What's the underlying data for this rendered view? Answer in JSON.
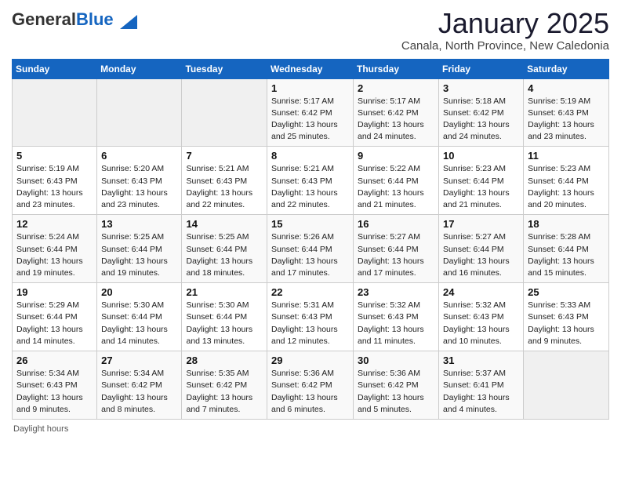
{
  "header": {
    "logo_general": "General",
    "logo_blue": "Blue",
    "title": "January 2025",
    "subtitle": "Canala, North Province, New Caledonia"
  },
  "days_of_week": [
    "Sunday",
    "Monday",
    "Tuesday",
    "Wednesday",
    "Thursday",
    "Friday",
    "Saturday"
  ],
  "weeks": [
    [
      {
        "day": "",
        "info": ""
      },
      {
        "day": "",
        "info": ""
      },
      {
        "day": "",
        "info": ""
      },
      {
        "day": "1",
        "info": "Sunrise: 5:17 AM\nSunset: 6:42 PM\nDaylight: 13 hours and 25 minutes."
      },
      {
        "day": "2",
        "info": "Sunrise: 5:17 AM\nSunset: 6:42 PM\nDaylight: 13 hours and 24 minutes."
      },
      {
        "day": "3",
        "info": "Sunrise: 5:18 AM\nSunset: 6:42 PM\nDaylight: 13 hours and 24 minutes."
      },
      {
        "day": "4",
        "info": "Sunrise: 5:19 AM\nSunset: 6:43 PM\nDaylight: 13 hours and 23 minutes."
      }
    ],
    [
      {
        "day": "5",
        "info": "Sunrise: 5:19 AM\nSunset: 6:43 PM\nDaylight: 13 hours and 23 minutes."
      },
      {
        "day": "6",
        "info": "Sunrise: 5:20 AM\nSunset: 6:43 PM\nDaylight: 13 hours and 23 minutes."
      },
      {
        "day": "7",
        "info": "Sunrise: 5:21 AM\nSunset: 6:43 PM\nDaylight: 13 hours and 22 minutes."
      },
      {
        "day": "8",
        "info": "Sunrise: 5:21 AM\nSunset: 6:43 PM\nDaylight: 13 hours and 22 minutes."
      },
      {
        "day": "9",
        "info": "Sunrise: 5:22 AM\nSunset: 6:44 PM\nDaylight: 13 hours and 21 minutes."
      },
      {
        "day": "10",
        "info": "Sunrise: 5:23 AM\nSunset: 6:44 PM\nDaylight: 13 hours and 21 minutes."
      },
      {
        "day": "11",
        "info": "Sunrise: 5:23 AM\nSunset: 6:44 PM\nDaylight: 13 hours and 20 minutes."
      }
    ],
    [
      {
        "day": "12",
        "info": "Sunrise: 5:24 AM\nSunset: 6:44 PM\nDaylight: 13 hours and 19 minutes."
      },
      {
        "day": "13",
        "info": "Sunrise: 5:25 AM\nSunset: 6:44 PM\nDaylight: 13 hours and 19 minutes."
      },
      {
        "day": "14",
        "info": "Sunrise: 5:25 AM\nSunset: 6:44 PM\nDaylight: 13 hours and 18 minutes."
      },
      {
        "day": "15",
        "info": "Sunrise: 5:26 AM\nSunset: 6:44 PM\nDaylight: 13 hours and 17 minutes."
      },
      {
        "day": "16",
        "info": "Sunrise: 5:27 AM\nSunset: 6:44 PM\nDaylight: 13 hours and 17 minutes."
      },
      {
        "day": "17",
        "info": "Sunrise: 5:27 AM\nSunset: 6:44 PM\nDaylight: 13 hours and 16 minutes."
      },
      {
        "day": "18",
        "info": "Sunrise: 5:28 AM\nSunset: 6:44 PM\nDaylight: 13 hours and 15 minutes."
      }
    ],
    [
      {
        "day": "19",
        "info": "Sunrise: 5:29 AM\nSunset: 6:44 PM\nDaylight: 13 hours and 14 minutes."
      },
      {
        "day": "20",
        "info": "Sunrise: 5:30 AM\nSunset: 6:44 PM\nDaylight: 13 hours and 14 minutes."
      },
      {
        "day": "21",
        "info": "Sunrise: 5:30 AM\nSunset: 6:44 PM\nDaylight: 13 hours and 13 minutes."
      },
      {
        "day": "22",
        "info": "Sunrise: 5:31 AM\nSunset: 6:43 PM\nDaylight: 13 hours and 12 minutes."
      },
      {
        "day": "23",
        "info": "Sunrise: 5:32 AM\nSunset: 6:43 PM\nDaylight: 13 hours and 11 minutes."
      },
      {
        "day": "24",
        "info": "Sunrise: 5:32 AM\nSunset: 6:43 PM\nDaylight: 13 hours and 10 minutes."
      },
      {
        "day": "25",
        "info": "Sunrise: 5:33 AM\nSunset: 6:43 PM\nDaylight: 13 hours and 9 minutes."
      }
    ],
    [
      {
        "day": "26",
        "info": "Sunrise: 5:34 AM\nSunset: 6:43 PM\nDaylight: 13 hours and 9 minutes."
      },
      {
        "day": "27",
        "info": "Sunrise: 5:34 AM\nSunset: 6:42 PM\nDaylight: 13 hours and 8 minutes."
      },
      {
        "day": "28",
        "info": "Sunrise: 5:35 AM\nSunset: 6:42 PM\nDaylight: 13 hours and 7 minutes."
      },
      {
        "day": "29",
        "info": "Sunrise: 5:36 AM\nSunset: 6:42 PM\nDaylight: 13 hours and 6 minutes."
      },
      {
        "day": "30",
        "info": "Sunrise: 5:36 AM\nSunset: 6:42 PM\nDaylight: 13 hours and 5 minutes."
      },
      {
        "day": "31",
        "info": "Sunrise: 5:37 AM\nSunset: 6:41 PM\nDaylight: 13 hours and 4 minutes."
      },
      {
        "day": "",
        "info": ""
      }
    ]
  ],
  "footer": "Daylight hours"
}
